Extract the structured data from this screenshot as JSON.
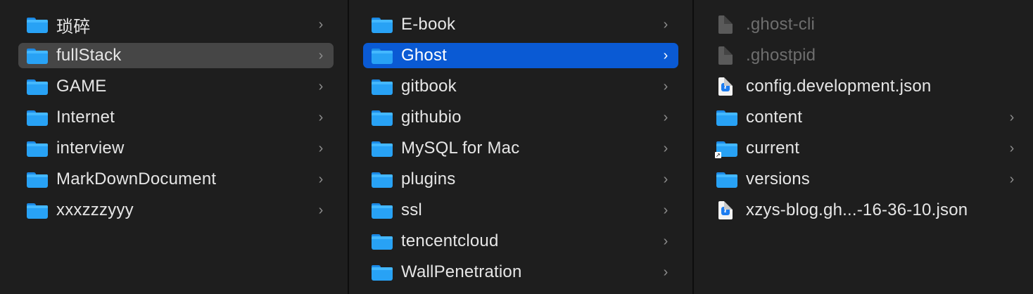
{
  "columns": [
    {
      "items": [
        {
          "label": "琐碎",
          "icon": "folder-icon",
          "chevron": "›"
        },
        {
          "label": "fullStack",
          "icon": "folder-icon",
          "chevron": "›"
        },
        {
          "label": "GAME",
          "icon": "folder-icon",
          "chevron": "›"
        },
        {
          "label": "Internet",
          "icon": "folder-icon",
          "chevron": "›"
        },
        {
          "label": "interview",
          "icon": "folder-icon",
          "chevron": "›"
        },
        {
          "label": "MarkDownDocument",
          "icon": "folder-icon",
          "chevron": "›"
        },
        {
          "label": "xxxzzzyyy",
          "icon": "folder-icon",
          "chevron": "›"
        }
      ]
    },
    {
      "items": [
        {
          "label": "E-book",
          "icon": "folder-icon",
          "chevron": "›"
        },
        {
          "label": "Ghost",
          "icon": "folder-icon",
          "chevron": "›"
        },
        {
          "label": "gitbook",
          "icon": "folder-icon",
          "chevron": "›"
        },
        {
          "label": "githubio",
          "icon": "folder-icon",
          "chevron": "›"
        },
        {
          "label": "MySQL for Mac",
          "icon": "folder-icon",
          "chevron": "›"
        },
        {
          "label": "plugins",
          "icon": "folder-icon",
          "chevron": "›"
        },
        {
          "label": "ssl",
          "icon": "folder-icon",
          "chevron": "›"
        },
        {
          "label": "tencentcloud",
          "icon": "folder-icon",
          "chevron": "›"
        },
        {
          "label": "WallPenetration",
          "icon": "folder-icon",
          "chevron": "›"
        }
      ]
    },
    {
      "items": [
        {
          "label": ".ghost-cli",
          "icon": "hidden-file-icon"
        },
        {
          "label": ".ghostpid",
          "icon": "hidden-file-icon"
        },
        {
          "label": "config.development.json",
          "icon": "json-file-icon"
        },
        {
          "label": "content",
          "icon": "folder-icon",
          "chevron": "›"
        },
        {
          "label": "current",
          "icon": "folder-alias-icon",
          "chevron": "›"
        },
        {
          "label": "versions",
          "icon": "folder-icon",
          "chevron": "›"
        },
        {
          "label": "xzys-blog.gh...-16-36-10.json",
          "icon": "json-file-icon"
        }
      ]
    }
  ],
  "selection": {
    "column1": "fullStack",
    "column2": "Ghost"
  },
  "colors": {
    "background": "#1e1e1e",
    "selected_active": "#0a5ad4",
    "selected_inactive": "#464646",
    "folder_blue": "#28a2f5"
  }
}
